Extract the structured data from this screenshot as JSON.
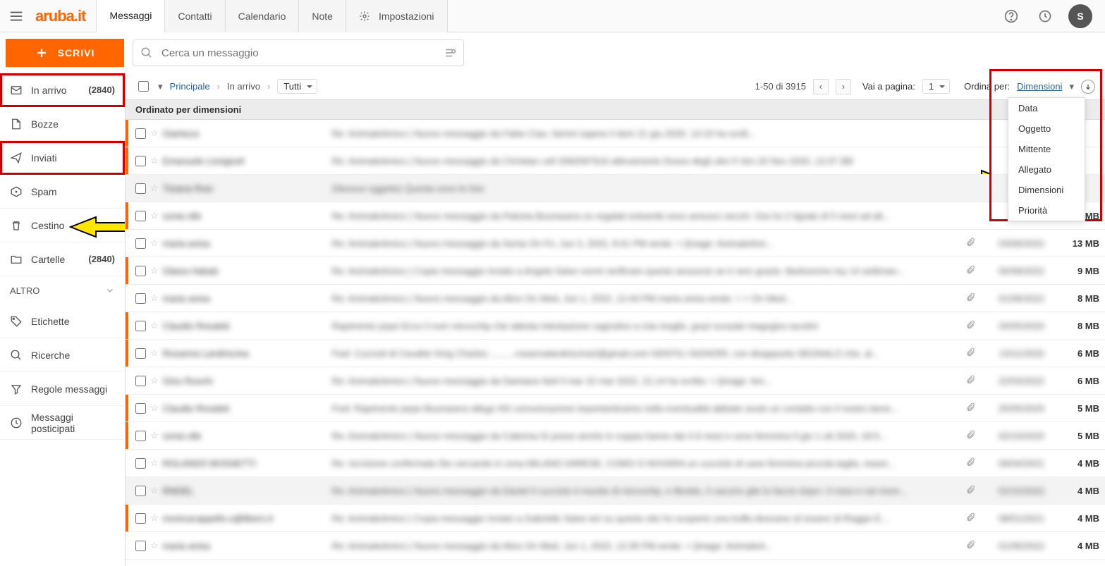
{
  "brand": "aruba.it",
  "avatar": "S",
  "tabs": [
    {
      "label": "Messaggi",
      "active": true
    },
    {
      "label": "Contatti"
    },
    {
      "label": "Calendario"
    },
    {
      "label": "Note"
    },
    {
      "label": "Impostazioni",
      "icon": "gear"
    }
  ],
  "compose": "SCRIVI",
  "search": {
    "placeholder": "Cerca un messaggio"
  },
  "sidebar": {
    "items": [
      {
        "icon": "inbox",
        "label": "In arrivo",
        "count": "(2840)",
        "hl": true
      },
      {
        "icon": "draft",
        "label": "Bozze"
      },
      {
        "icon": "sent",
        "label": "Inviati",
        "hl": true
      },
      {
        "icon": "spam",
        "label": "Spam"
      },
      {
        "icon": "trash",
        "label": "Cestino",
        "arrow": true
      },
      {
        "icon": "folder",
        "label": "Cartelle",
        "count": "(2840)"
      }
    ],
    "group": "ALTRO",
    "extra": [
      {
        "icon": "tag",
        "label": "Etichette"
      },
      {
        "icon": "search",
        "label": "Ricerche"
      },
      {
        "icon": "filter",
        "label": "Regole messaggi"
      },
      {
        "icon": "clock",
        "label": "Messaggi posticipati"
      }
    ]
  },
  "breadcrumb": {
    "root": "Principale",
    "folder": "In arrivo",
    "filter": "Tutti"
  },
  "pagination": {
    "range": "1-50 di 3915",
    "gotoLabel": "Vai a pagina:",
    "page": "1"
  },
  "sort": {
    "label": "Ordina per:",
    "current": "Dimensioni",
    "options": [
      "Data",
      "Oggetto",
      "Mittente",
      "Allegato",
      "Dimensioni",
      "Priorità"
    ]
  },
  "groupHeader": "Ordinato per dimensioni",
  "messages": [
    {
      "unread": true,
      "sender": "Gianluca",
      "subject": "Re: AnimaleAmico | Nuovo messaggio da Fabio Ciao, fammi sapere il dom 21 giu 2020, 14:10 <supporto@animaleamico.com> ha scritt...",
      "date": "21/",
      "size": ""
    },
    {
      "unread": true,
      "sender": "Emanuele Lissignoli",
      "subject": "Re: AnimaleAmico | Nuovo messaggio da Christian cell 3392097616 allevamento Dosso degli ulivi Il Ven 20 Nov 2020, 13:37 <supporto...",
      "date": "20/",
      "size": ""
    },
    {
      "sel": true,
      "sender": "Tiziana Rosi",
      "subject": "(Nessun oggetto) Questa sono le foto",
      "date": "",
      "size": ""
    },
    {
      "unread": true,
      "sender": "sonia olle",
      "subject": "Re: AnimaleAmico | Nuovo messaggio da Patrizia Buonasera no regalati entrambi sono annunci vecchi. Ora ho 2 tigrate di 5 mesi ad alt...",
      "date": "",
      "size": "14 MB"
    },
    {
      "sender": "maria anisa",
      "subject": "Re: AnimaleAmico | Nuovo messaggio da Sonia On Fri, Jun 3, 2022, 8:41 PM <supporto@animaleamico.com> wrote: > [image: AnimaleAmi...",
      "clip": true,
      "date": "03/06/2022",
      "size": "13 MB"
    },
    {
      "unread": true,
      "sender": "Glaiza Habab",
      "subject": "Re: AnimaleAmico | Copia messaggio inviato a Angela Salve vorrei verificare questo annuncio se è vero grazie. Barboncino toy 14 settiman...",
      "clip": true,
      "date": "05/08/2022",
      "size": "9 MB"
    },
    {
      "sender": "maria anisa",
      "subject": "Re: AnimaleAmico | Nuovo messaggio da Alice On Wed, Jun 1, 2022, 12:44 PM maria anisa <mantosal68@gmail.com> wrote: > > On Wed...",
      "clip": true,
      "date": "01/06/2022",
      "size": "8 MB"
    },
    {
      "unread": true,
      "sender": "Claudio Rosaleti",
      "subject": "Rapimento pepe Ecco il num microchip che attesta intestazione cagnolino a mia moglie, grazi scusate magogira racolmi",
      "clip": true,
      "date": "25/05/2020",
      "size": "8 MB"
    },
    {
      "unread": true,
      "sender": "Rosanna Landriscina",
      "subject": "Fwd: Cuccioli di Cavalier King Charles...........rosannalandriscina2@gmail.com GENTILI SIGNORI, con disappunto SEGNALO che, al...",
      "clip": true,
      "date": "13/11/2020",
      "size": "6 MB"
    },
    {
      "sender": "Gino Ruschi",
      "subject": "Re: AnimaleAmico | Nuovo messaggio da Damiano Noli Il mar 22 mar 2022, 21:14 <supporto@animaleamico.com> ha scritto: > [image: Ani...",
      "clip": true,
      "date": "22/03/2022",
      "size": "6 MB"
    },
    {
      "unread": true,
      "sender": "Claudio Rosaleti",
      "subject": "Fwd: Rapimento pepe Buonasera allego NS comunicazione importantissima nella eventualità abbiate avuto un contatto con il nostro bene...",
      "clip": true,
      "date": "25/05/2020",
      "size": "5 MB"
    },
    {
      "unread": true,
      "sender": "sonia olle",
      "subject": "Re: AnimaleAmico | Nuovo messaggio da Caterina Sì posso anche in coppia hanno dai 4-6 mesi e sono femmina Il gio 1 ott 2020, 18:5...",
      "clip": true,
      "date": "02/10/2020",
      "size": "5 MB"
    },
    {
      "sender": "ROLANDO BOSSETTI",
      "subject": "Re: Iscrizione confermata Sto cercando in zona MILANO,VARESE, COMO O NOVARA un cucciolo di cane femmina piccola taglia, massi...",
      "clip": true,
      "date": "06/04/2021",
      "size": "4 MB"
    },
    {
      "sel": true,
      "sender": "RNDEL",
      "subject": "Re: AnimaleAmico | Nuovo messaggio da Daniel Il cucciolo è munito di microchip, e libretto, il vaccino glie lo faccio dopo i 3 mesi e nel mom...",
      "clip": true,
      "date": "02/10/2022",
      "size": "4 MB"
    },
    {
      "unread": true,
      "sender": "monicacappello.o@libero.it",
      "subject": "Re: AnimaleAmico | Copia messaggio inviato a Gabrielle Salve ieri su questo sito ho scoperto una truffa dicevano di essere di Reggio E...",
      "clip": true,
      "date": "08/01/2021",
      "size": "4 MB"
    },
    {
      "sender": "maria anisa",
      "subject": "Re: AnimaleAmico | Nuovo messaggio da Alice On Wed, Jun 1, 2022, 12:35 PM <supporto@animaleamico.com> wrote: > [image: AnimaleA...",
      "clip": true,
      "date": "01/06/2022",
      "size": "4 MB"
    }
  ]
}
